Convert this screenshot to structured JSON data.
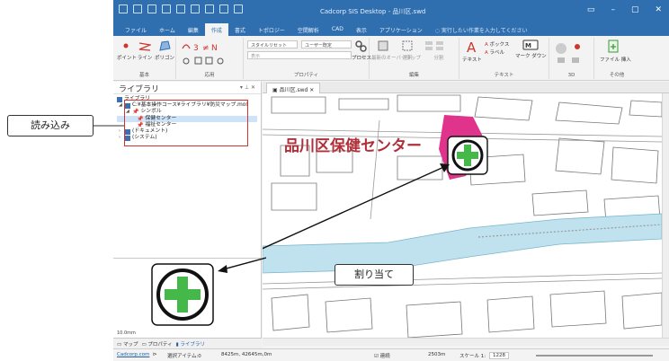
{
  "window": {
    "title": "Cadcorp SIS Desktop - 品川区.swd",
    "controls": [
      "▭",
      "–",
      "▢",
      "✕"
    ]
  },
  "ribbon_tabs": [
    "ファイル",
    "ホーム",
    "編集",
    "作成",
    "書式",
    "トポロジー",
    "空間解析",
    "CAD",
    "表示",
    "アプリケーション"
  ],
  "active_tab": "作成",
  "tell_me": "実行したい作業を入力してください",
  "ribbon": {
    "groups": [
      {
        "label": "基本",
        "buttons": [
          "ポイント",
          "ライン",
          "ポリゴン"
        ]
      },
      {
        "label": "応用",
        "buttons": []
      },
      {
        "label": "プロパティ",
        "dropdowns": [
          "スタイルリセット",
          "ユーザー既定",
          "表示"
        ],
        "buttons": [
          "プロセス"
        ]
      },
      {
        "label": "編集",
        "buttons": [
          "最新のオーバーラップ",
          "選択",
          "分割"
        ]
      },
      {
        "label": "テキスト",
        "buttons": [
          "ボックス",
          "ラベル",
          "マーク ダウン",
          "テキスト"
        ]
      },
      {
        "label": "3D",
        "buttons": []
      },
      {
        "label": "その他",
        "buttons": [
          "ファイル 挿入"
        ]
      }
    ]
  },
  "library_panel": {
    "title": "ライブラリ",
    "tree": [
      {
        "label": "ライブラリ",
        "level": 0
      },
      {
        "label": "C:¥基本操作コース¥ライブラリ¥防災マップ.mol",
        "level": 1
      },
      {
        "label": "シンボル",
        "level": 2
      },
      {
        "label": "保健センター",
        "level": 3,
        "selected": true
      },
      {
        "label": "福祉センター",
        "level": 3
      },
      {
        "label": "(ドキュメント)",
        "level": 1
      },
      {
        "label": "(システム)",
        "level": 1
      }
    ]
  },
  "preview": {
    "scale": "10.0mm"
  },
  "bottom_tabs": [
    "マップ",
    "プロパティ",
    "ライブラリ"
  ],
  "active_bottom_tab": "ライブラリ",
  "document_tab": "品川区.swd",
  "map": {
    "label": "品川区保健センター",
    "label_color": "#b0303a",
    "marker_color": "#e0338c",
    "cross_color": "#45b84a"
  },
  "status_bar": {
    "coords": "Cadcorp.com",
    "item1": "選択アイテム:0",
    "item2": "8425m, 42645m,0m",
    "item3": "☑ 連続",
    "zoom": "2503m",
    "scale_label": "スケール 1:",
    "scale_value": "1228"
  },
  "callouts": {
    "load": "読み込み",
    "assign": "割り当て"
  }
}
